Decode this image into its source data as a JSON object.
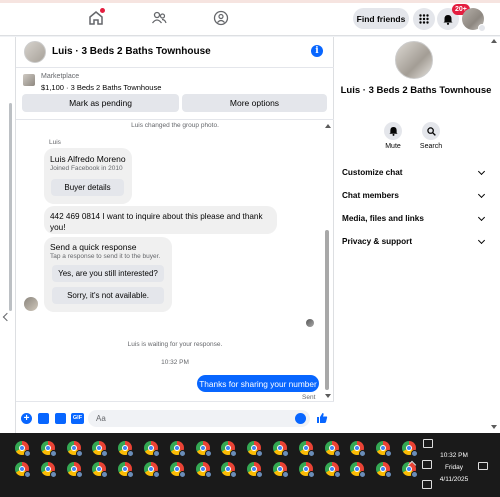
{
  "topbar": {
    "find_friends": "Find friends",
    "notification_badge": "20+",
    "icons": [
      "home-icon",
      "friends-icon",
      "groups-icon",
      "menu-icon",
      "bell-icon"
    ]
  },
  "chat": {
    "title": "Luis · 3 Beds 2 Baths Townhouse",
    "marketplace_label": "Marketplace",
    "listing": "$1,100 · 3 Beds 2 Baths Townhouse",
    "mark_pending": "Mark as pending",
    "more_options": "More options",
    "sys_photo": "Luis changed the group photo.",
    "sender": "Luis",
    "profile_name": "Luis Alfredo Moreno",
    "profile_sub": "Joined Facebook in 2010",
    "buyer_details": "Buyer details",
    "message": "442 469 0814 I want to inquire about this please and thank you!",
    "quick_title": "Send a quick response",
    "quick_sub": "Tap a response to send it to the buyer.",
    "quick_1": "Yes, are you still interested?",
    "quick_2": "Sorry, it's not available.",
    "waiting": "Luis is waiting for your response.",
    "time": "10:32 PM",
    "outgoing": "Thanks for sharing your number",
    "sent": "Sent",
    "composer_placeholder": "Aa",
    "gif_label": "GIF"
  },
  "right_panel": {
    "title": "Luis · 3 Beds 2 Baths Townhouse",
    "mute": "Mute",
    "search": "Search",
    "sections": [
      "Customize chat",
      "Chat members",
      "Media, files and links",
      "Privacy & support"
    ]
  },
  "taskbar": {
    "time": "10:32 PM",
    "day": "Friday",
    "date": "4/11/2025"
  }
}
